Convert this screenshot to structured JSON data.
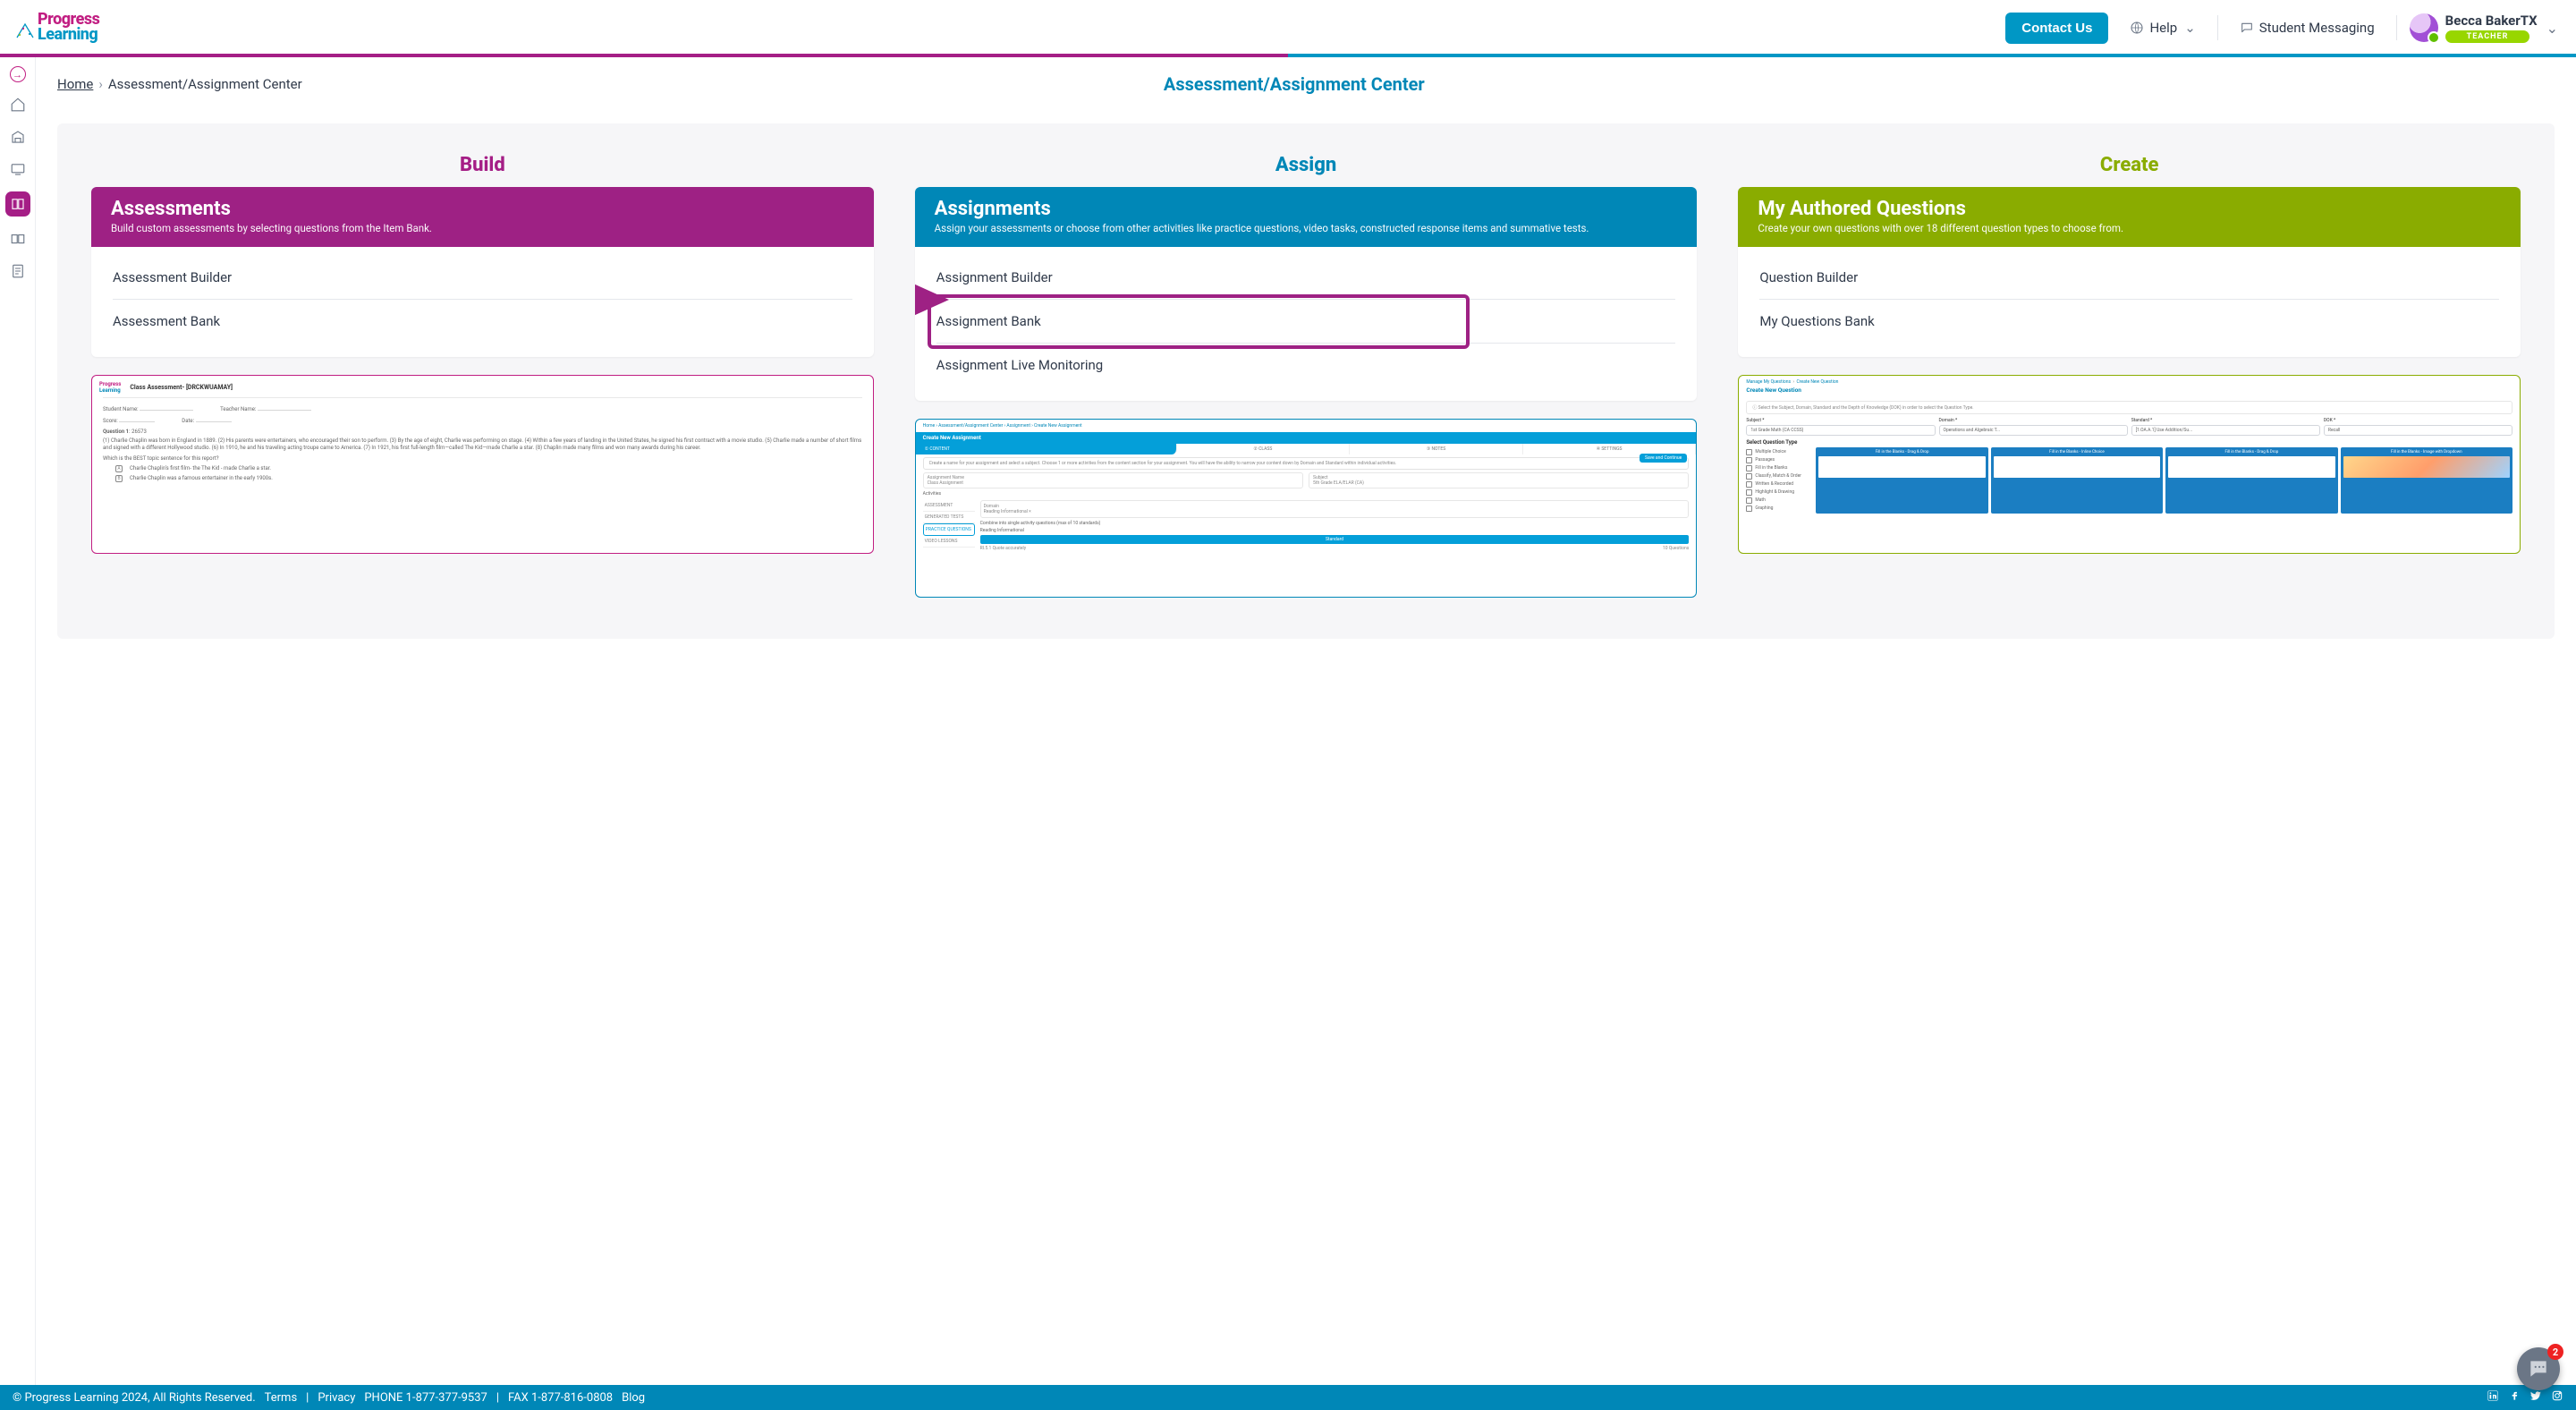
{
  "brand": {
    "name_top": "Progress",
    "name_bottom": "Learning"
  },
  "nav": {
    "contact": "Contact Us",
    "help": "Help",
    "messaging": "Student Messaging",
    "user": {
      "name": "Becca BakerTX",
      "role": "TEACHER"
    }
  },
  "breadcrumb": {
    "home": "Home",
    "current": "Assessment/Assignment Center"
  },
  "page_title": "Assessment/Assignment Center",
  "cols": {
    "build": {
      "heading": "Build",
      "card_title": "Assessments",
      "card_sub": "Build custom assessments by selecting questions from the Item Bank.",
      "items": [
        "Assessment Builder",
        "Assessment Bank"
      ]
    },
    "assign": {
      "heading": "Assign",
      "card_title": "Assignments",
      "card_sub": "Assign your assessments or choose from other activities like practice questions, video tasks, constructed response items and summative tests.",
      "items": [
        "Assignment Builder",
        "Assignment Bank",
        "Assignment Live Monitoring"
      ]
    },
    "create": {
      "heading": "Create",
      "card_title": "My Authored Questions",
      "card_sub": "Create your own questions with over 18 different question types to choose from.",
      "items": [
        "Question Builder",
        "My Questions Bank"
      ]
    }
  },
  "preview": {
    "build": {
      "title": "Class Assessment- [DRCKWUAMAY]",
      "labels": {
        "student": "Student Name:",
        "teacher": "Teacher Name:",
        "score": "Score:",
        "date": "Date:"
      },
      "question_num": "Question 1",
      "question_id": ": 26573",
      "passage": "(1) Charlie Chaplin was born in England in 1889. (2) His parents were entertainers, who encouraged their son to perform. (3) By the age of eight, Charlie was performing on stage. (4) Within a few years of landing in the United States, he signed his first contract with a movie studio. (5) Charlie made a number of short films and signed with a different Hollywood studio. (6) In 1910, he and his traveling acting troupe came to America. (7) In 1921, his first full-length film—called The Kid—made Charlie a star. (8) Chaplin made many films and won many awards during his career.",
      "prompt": "Which is the BEST topic sentence for this report?",
      "opt_a": "Charlie Chaplin's first film- the The Kid - made Charlie a star.",
      "opt_b": "Charlie Chaplin was a famous entertainer in the early 1900s."
    },
    "assign": {
      "crumb": "Home  ›  Assessment/Assignment Center  ›  Assignment  ›  Create New Assignment",
      "title": "Create New Assignment",
      "tabs": [
        "CONTENT",
        "CLASS",
        "NOTES",
        "SETTINGS"
      ],
      "hint": "Create a name for your assignment and select a subject. Choose 1 or more activities from the content section for your assignment. You will have the ability to narrow your content down by Domain and Standard within individual activities.",
      "fields": {
        "name": "Assignment Name",
        "subject": "Subject",
        "value": "5th Grade ELA/ELAR (CA)"
      },
      "save": "Save and Continue",
      "activities_label": "Activities",
      "side": [
        "ASSESSMENT",
        "GENERATED TESTS",
        "PRACTICE QUESTIONS",
        "VIDEO LESSONS"
      ],
      "domain_label": "Domain",
      "domain_value": "Reading Informational ×",
      "combine": "Combine into single activity questions (max of 10 standards)",
      "sub_head": "Reading Informational",
      "bar": "Standard",
      "foot_l": "RI.5.1 Quote accurately",
      "foot_r": "10 Questions"
    },
    "create": {
      "crumb1": "Manage My Questions",
      "crumb2": "Create New Question",
      "title": "Create New Question",
      "note": "Select the Subject, Domain, Standard and the Depth of Knowledge (DOK) in order to select the Question Type.",
      "fields": [
        {
          "label": "Subject *",
          "value": "1st Grade Math (CA CCSS)"
        },
        {
          "label": "Domain *",
          "value": "Operations and Algebraic T..."
        },
        {
          "label": "Standard *",
          "value": "[1.OA.A.1] Use Addition/Su..."
        },
        {
          "label": "DOK *",
          "value": "Recall"
        }
      ],
      "section": "Select Question Type",
      "types": [
        "Multiple Choice",
        "Passages",
        "Fill in the Blanks",
        "Classify, Match & Order",
        "Written & Recorded",
        "Highlight & Drawing",
        "Math",
        "Graphing"
      ],
      "tiles": [
        "Fill in the Blanks - Drag & Drop",
        "Fill in the Blanks - Inline Choice",
        "Fill in the Blanks - Drag & Drop",
        "Fill in the Blanks - Image with Dropdown"
      ]
    }
  },
  "footer": {
    "copyright": "© Progress Learning 2024, All Rights Reserved.",
    "terms": "Terms",
    "sep": "|",
    "privacy": "Privacy",
    "phone": "PHONE 1-877-377-9537",
    "fax": "FAX 1-877-816-0808",
    "blog": "Blog"
  },
  "chat_badge": "2"
}
